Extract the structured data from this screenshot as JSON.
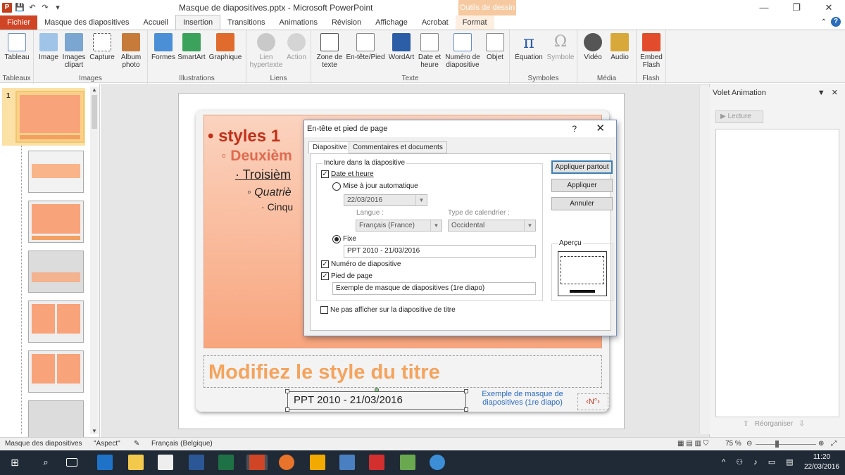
{
  "window": {
    "title": "Masque de diapositives.pptx - Microsoft PowerPoint",
    "context_tab_header": "Outils de dessin",
    "controls": [
      "—",
      "❐",
      "✕"
    ]
  },
  "tabs": [
    "Fichier",
    "Masque des diapositives",
    "Accueil",
    "Insertion",
    "Transitions",
    "Animations",
    "Révision",
    "Affichage",
    "Acrobat",
    "Format"
  ],
  "ribbon": {
    "groups": [
      {
        "label": "Tableaux",
        "buttons": [
          "Tableau"
        ]
      },
      {
        "label": "Images",
        "buttons": [
          "Image",
          "Images clipart",
          "Capture",
          "Album photo"
        ]
      },
      {
        "label": "Illustrations",
        "buttons": [
          "Formes",
          "SmartArt",
          "Graphique"
        ]
      },
      {
        "label": "Liens",
        "buttons": [
          "Lien hypertexte",
          "Action"
        ]
      },
      {
        "label": "Texte",
        "buttons": [
          "Zone de texte",
          "En-tête/Pied",
          "WordArt",
          "Date et heure",
          "Numéro de diapositive",
          "Objet"
        ]
      },
      {
        "label": "Symboles",
        "buttons": [
          "Équation",
          "Symbole"
        ]
      },
      {
        "label": "Média",
        "buttons": [
          "Vidéo",
          "Audio"
        ]
      },
      {
        "label": "Flash",
        "buttons": [
          "Embed Flash"
        ]
      }
    ]
  },
  "slide_panel": {
    "first_num": "1"
  },
  "slide": {
    "bullets": [
      "styles 1",
      "Deuxièm",
      "Troisièm",
      "Quatriè",
      "Cinqu"
    ],
    "title": "Modifiez le style du titre",
    "footer_date": "PPT 2010 - 21/03/2016",
    "footer_text": "Exemple de masque de diapositives (1re diapo)",
    "slide_num": "‹N°›"
  },
  "dialog": {
    "title": "En-tête et pied de page",
    "help": "?",
    "close": "✕",
    "tabs": [
      "Diapositive",
      "Commentaires et documents"
    ],
    "group_label": "Inclure dans la diapositive",
    "date_heure": "Date et heure",
    "mise_a_jour": "Mise à jour automatique",
    "date_value": "22/03/2016",
    "langue_label": "Langue :",
    "langue_value": "Français (France)",
    "calendrier_label": "Type de calendrier :",
    "calendrier_value": "Occidental",
    "fixe": "Fixe",
    "fixe_value": "PPT 2010 - 21/03/2016",
    "numero": "Numéro de diapositive",
    "pied": "Pied de page",
    "pied_value": "Exemple de masque de diapositives (1re diapo)",
    "ne_pas": "Ne pas afficher sur la diapositive de titre",
    "btn_partout": "Appliquer partout",
    "btn_appliquer": "Appliquer",
    "btn_annuler": "Annuler",
    "apercu": "Aperçu"
  },
  "taskpane": {
    "title": "Volet Animation",
    "lecture": "Lecture",
    "reorganiser": "Réorganiser"
  },
  "statusbar": {
    "view": "Masque des diapositives",
    "theme": "\"Aspect\"",
    "language": "Français (Belgique)",
    "zoom": "75 %"
  },
  "taskbar": {
    "time": "11:20",
    "date": "22/03/2016"
  },
  "colors": {
    "accent_file": "#d04525",
    "title_orange": "#f5a35d",
    "bullet_red": "#c0311a",
    "taskbar": "#1f2a36"
  }
}
